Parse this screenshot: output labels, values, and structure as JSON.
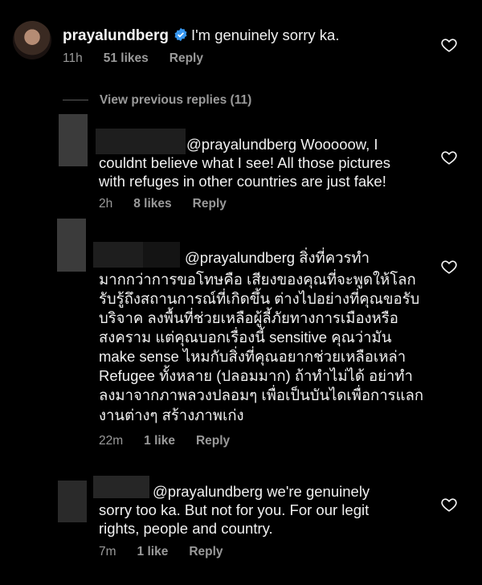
{
  "main_comment": {
    "username": "prayalundberg",
    "text": "I'm genuinely sorry ka.",
    "time": "11h",
    "likes": "51 likes",
    "reply": "Reply"
  },
  "view_previous": "View previous replies (11)",
  "replies": [
    {
      "lines": [
        "@prayalundberg Wooooow, I",
        "couldnt believe what I see! All those pictures",
        "with refuges in other countries are just fake!"
      ],
      "time": "2h",
      "likes": "8 likes",
      "reply": "Reply"
    },
    {
      "lines": [
        "@prayalundberg สิ่งที่ควรทำ",
        "มากกว่าการขอโทษคือ เสียงของคุณที่จะพูดให้โลก",
        "รับรู้ถึงสถานการณ์ที่เกิดขึ้น ต่างไปอย่างที่คุณขอรับ",
        "บริจาค ลงพื้นที่ช่วยเหลือผู้ลี้ภัยทางการเมืองหรือ",
        "สงคราม แต่คุณบอกเรื่องนี้ sensitive คุณว่ามัน",
        "make sense ไหมกับสิ่งที่คุณอยากช่วยเหลือเหล่า",
        "Refugee ทั้งหลาย (ปลอมมาก) ถ้าทำไม่ได้ อย่าทำ",
        "ลงมาจากภาพลวงปลอมๆ เพื่อเป็นบันไดเพื่อการแลก",
        "งานต่างๆ สร้างภาพเก่ง"
      ],
      "time": "22m",
      "likes": "1 like",
      "reply": "Reply"
    },
    {
      "lines": [
        "@prayalundberg we're genuinely",
        "sorry too ka. But not for you. For our legit",
        "rights, people and country."
      ],
      "time": "7m",
      "likes": "1 like",
      "reply": "Reply"
    }
  ],
  "colors": {
    "background": "#000000",
    "text": "#f5f5f5",
    "meta": "#9a9a9a",
    "verified": "#3797f0"
  },
  "icons": [
    "verified-badge-icon",
    "heart-icon"
  ]
}
